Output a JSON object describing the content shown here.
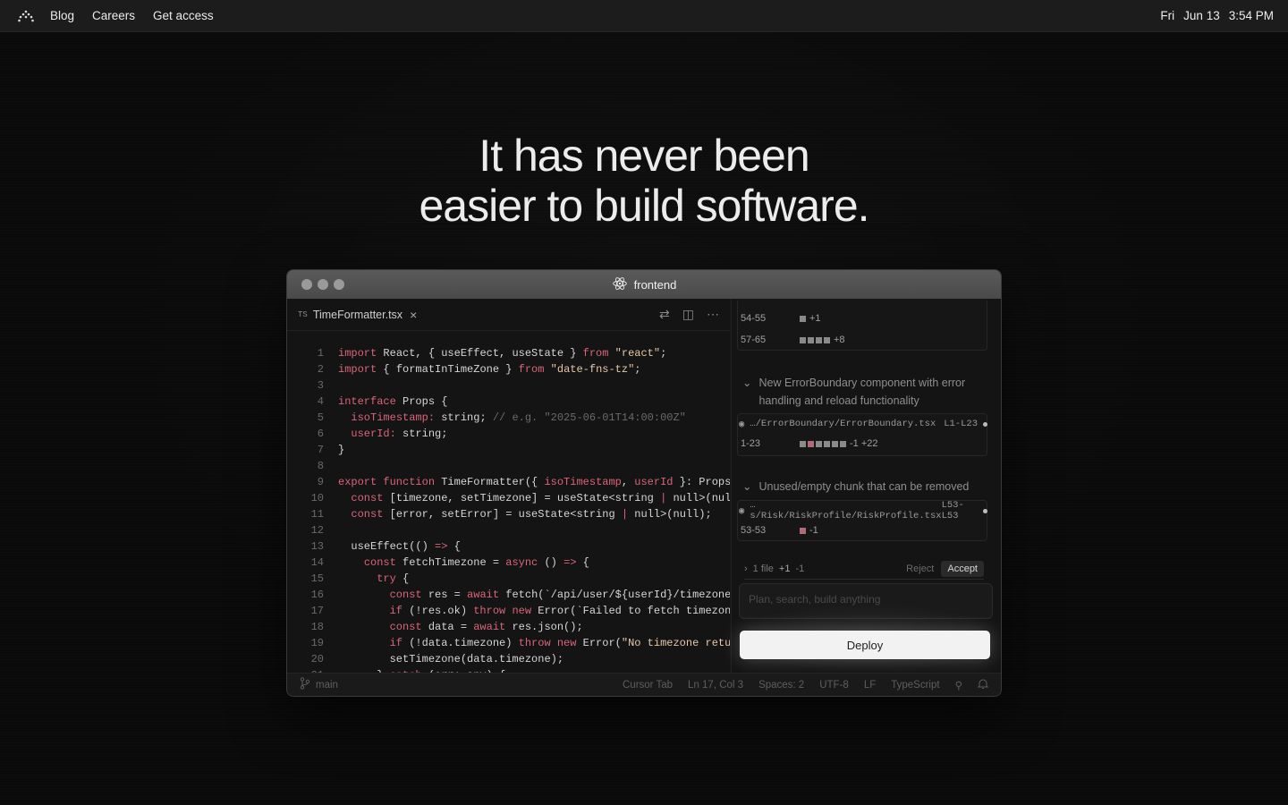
{
  "menubar": {
    "nav": [
      "Blog",
      "Careers",
      "Get access"
    ],
    "day": "Fri",
    "date": "Jun 13",
    "time": "3:54 PM"
  },
  "hero": {
    "line1": "It has never been",
    "line2": "easier to build software."
  },
  "window": {
    "title": "frontend",
    "tab": {
      "lang_badge": "TS",
      "filename": "TimeFormatter.tsx"
    }
  },
  "code_lines": [
    "1",
    "2",
    "3",
    "4",
    "5",
    "6",
    "7",
    "8",
    "9",
    "10",
    "11",
    "12",
    "13",
    "14",
    "15",
    "16",
    "17",
    "18",
    "19",
    "20",
    "21"
  ],
  "panel": {
    "top_rows": [
      {
        "range": "54-55",
        "delta": "+1",
        "blocks": 1
      },
      {
        "range": "57-65",
        "delta": "+8",
        "blocks": 4
      }
    ],
    "issue1": {
      "title": "New ErrorBoundary component with error handling and reload functionality",
      "file": "…/ErrorBoundary/ErrorBoundary.tsx",
      "loc": "L1-L23",
      "range": "1-23",
      "delta": "-1 +22"
    },
    "issue2": {
      "title": "Unused/empty chunk that can be removed",
      "file": "…s/Risk/RiskProfile/RiskProfile.tsx",
      "loc": "L53-L53",
      "range": "53-53",
      "delta": "-1"
    },
    "summary": {
      "files": "1 file",
      "plus": "+1",
      "minus": "-1",
      "reject": "Reject",
      "accept": "Accept"
    },
    "prompt_placeholder": "Plan, search, build anything",
    "deploy": "Deploy"
  },
  "statusbar": {
    "branch": "main",
    "items": [
      "Cursor Tab",
      "Ln 17, Col 3",
      "Spaces: 2",
      "UTF-8",
      "LF",
      "TypeScript"
    ]
  },
  "colors": {
    "keyword": "#d9657a",
    "string": "#e8c8a8",
    "comment": "#6a6a6a",
    "deploy_bg": "#f2f2f2"
  }
}
